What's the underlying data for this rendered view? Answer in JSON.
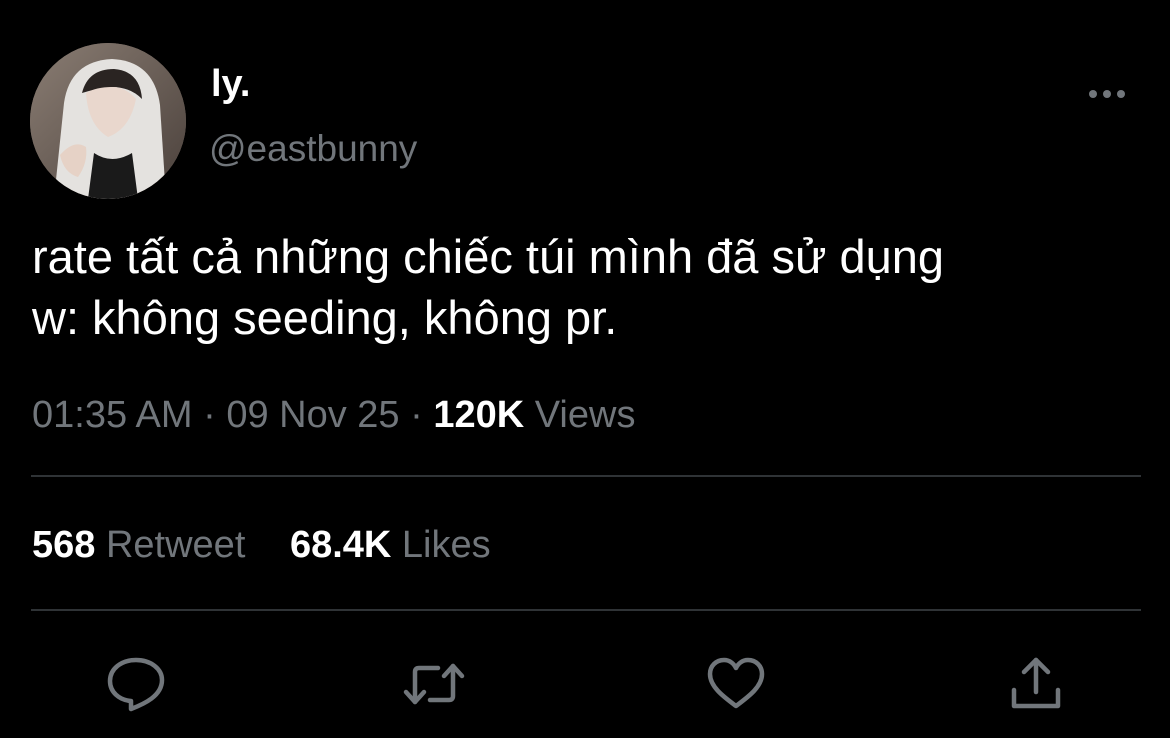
{
  "user": {
    "display_name": "ly.",
    "handle": "@eastbunny",
    "avatar_icon": "profile-photo"
  },
  "tweet": {
    "text_lines": [
      "rate tất cả những chiếc túi mình đã sử dụng",
      "w: không seeding, không pr."
    ]
  },
  "meta": {
    "time": "01:35 AM",
    "separator": "·",
    "date": "09 Nov 25",
    "views_count": "120K",
    "views_label": "Views"
  },
  "stats": {
    "retweets_count": "568",
    "retweets_label": "Retweet",
    "likes_count": "68.4K",
    "likes_label": "Likes"
  },
  "actions": [
    {
      "name": "reply",
      "icon": "comment-icon"
    },
    {
      "name": "retweet",
      "icon": "retweet-icon"
    },
    {
      "name": "like",
      "icon": "heart-icon"
    },
    {
      "name": "share",
      "icon": "share-icon"
    }
  ],
  "colors": {
    "background": "#000000",
    "primary_text": "#ffffff",
    "secondary_text": "#71767b",
    "divider": "#2f3336"
  }
}
